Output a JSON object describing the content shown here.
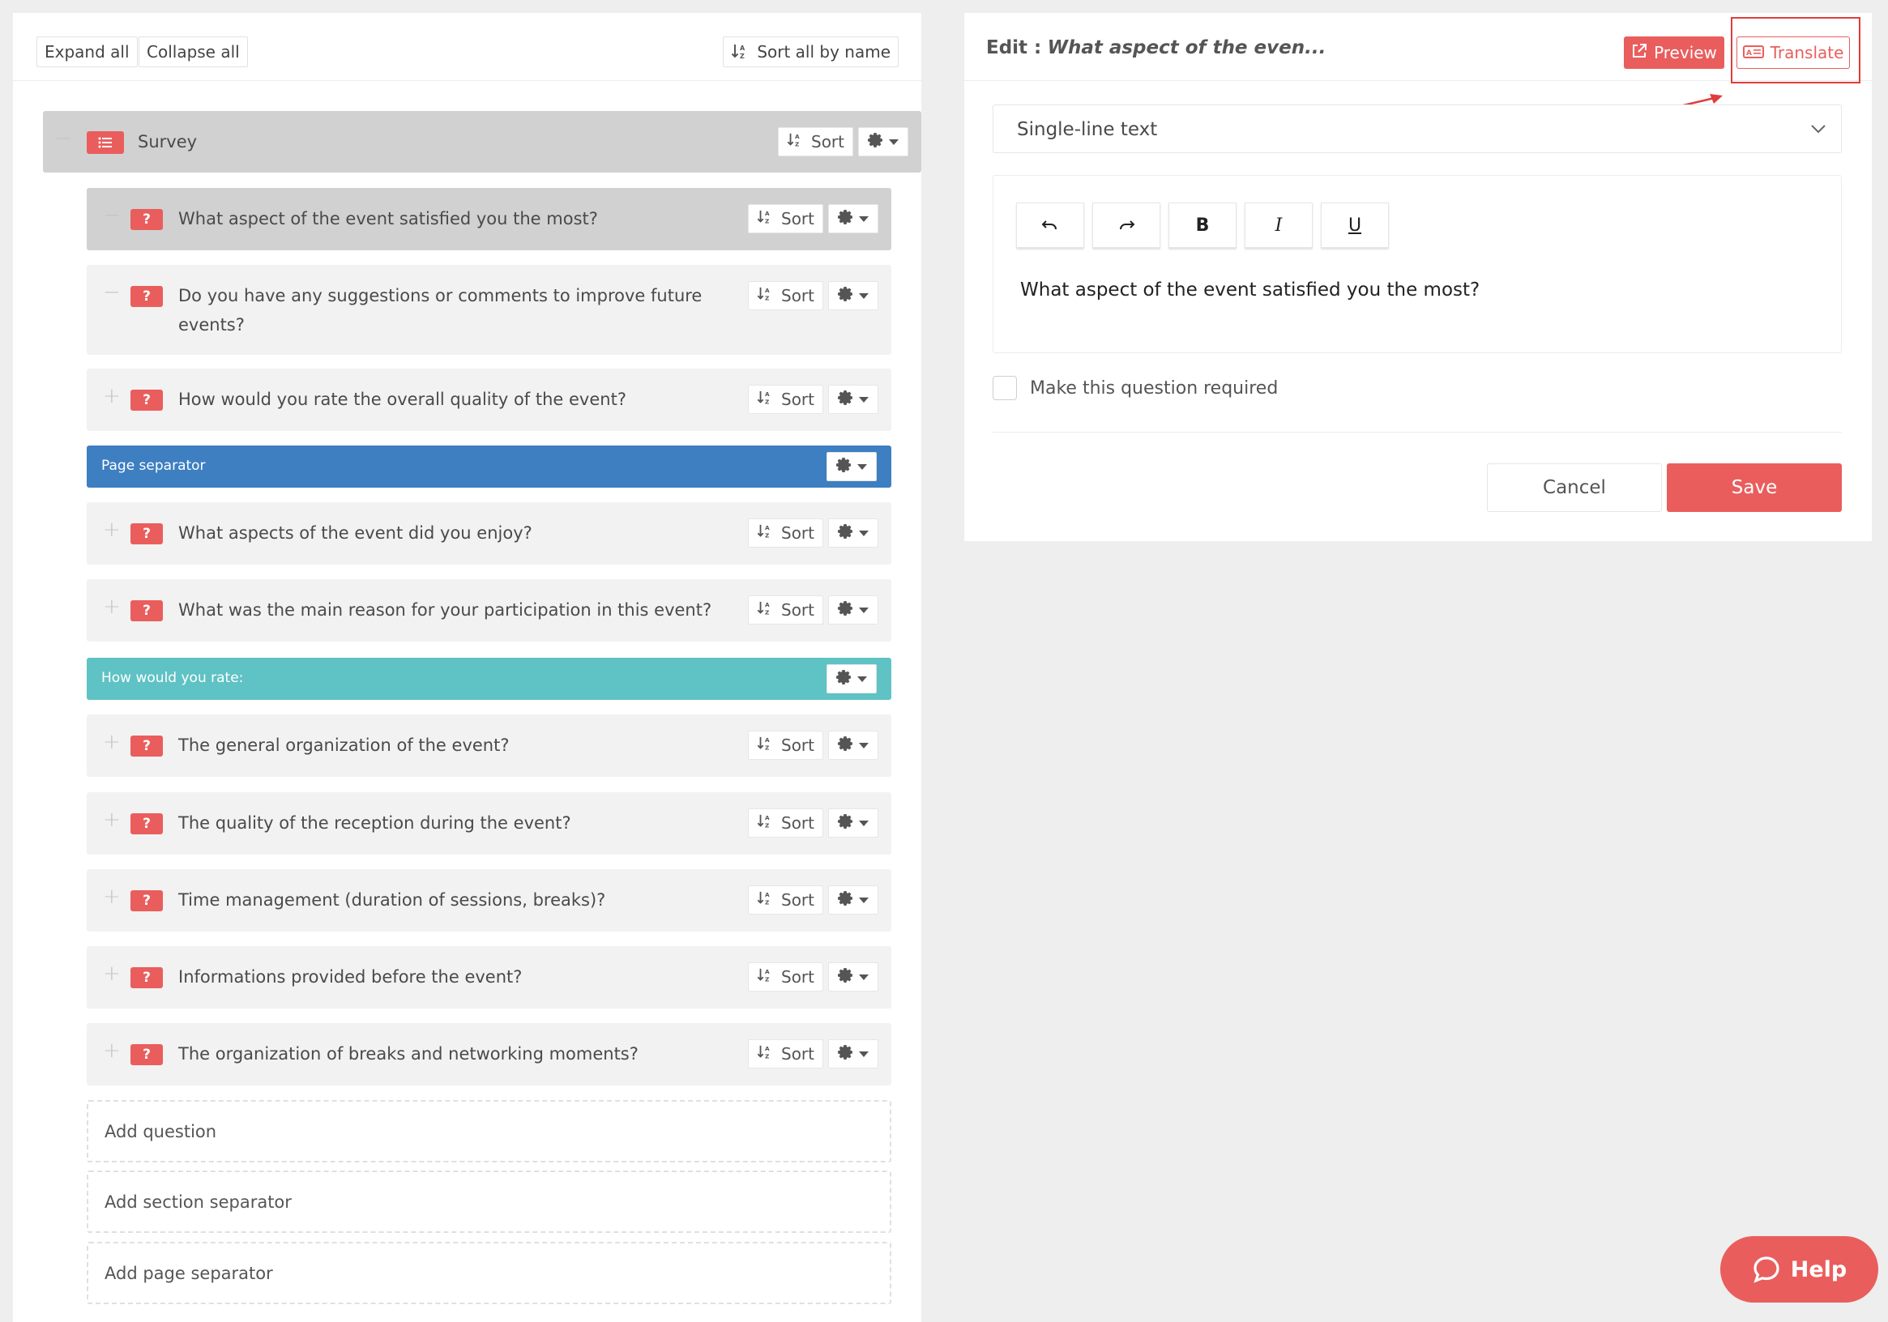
{
  "colors": {
    "accent": "#ea5d5d",
    "page_separator": "#3d7fc1",
    "section_separator": "#5fc2c4"
  },
  "toolbar": {
    "expand_all": "Expand all",
    "collapse_all": "Collapse all",
    "sort_all": "Sort all by name"
  },
  "tree": {
    "root": {
      "label": "Survey",
      "sort": "Sort"
    },
    "questions": [
      {
        "label": "What aspect of the event satisfied you the most?",
        "sort": "Sort",
        "toggle": "−"
      },
      {
        "label": "Do you have any suggestions or comments to improve future events?",
        "sort": "Sort",
        "toggle": "−"
      },
      {
        "label": "How would you rate the overall quality of the event?",
        "sort": "Sort",
        "toggle": "+"
      },
      {
        "label": "What aspects of the event did you enjoy?",
        "sort": "Sort",
        "toggle": "+"
      },
      {
        "label": "What was the main reason for your participation in this event?",
        "sort": "Sort",
        "toggle": "+"
      },
      {
        "label": "The general organization of the event?",
        "sort": "Sort",
        "toggle": "+"
      },
      {
        "label": "The quality of the reception during the event?",
        "sort": "Sort",
        "toggle": "+"
      },
      {
        "label": "Time management (duration of sessions, breaks)?",
        "sort": "Sort",
        "toggle": "+"
      },
      {
        "label": "Informations provided before the event?",
        "sort": "Sort",
        "toggle": "+"
      },
      {
        "label": "The organization of breaks and networking moments?",
        "sort": "Sort",
        "toggle": "+"
      }
    ],
    "page_separator": "Page separator",
    "section_separator": "How would you rate:",
    "question_badge": "?",
    "add_question": "Add question",
    "add_section_separator": "Add section separator",
    "add_page_separator": "Add page separator"
  },
  "editor": {
    "title_prefix": "Edit :",
    "title_question": "What aspect of the even...",
    "preview": "Preview",
    "translate": "Translate",
    "question_type": "Single-line text",
    "tools": {
      "undo": "↶",
      "redo": "↷",
      "bold": "B",
      "italic": "I",
      "underline": "U"
    },
    "content": "What aspect of the event satisfied you the most?",
    "required_label": "Make this question required",
    "required_checked": false,
    "cancel": "Cancel",
    "save": "Save"
  },
  "help": {
    "label": "Help"
  }
}
